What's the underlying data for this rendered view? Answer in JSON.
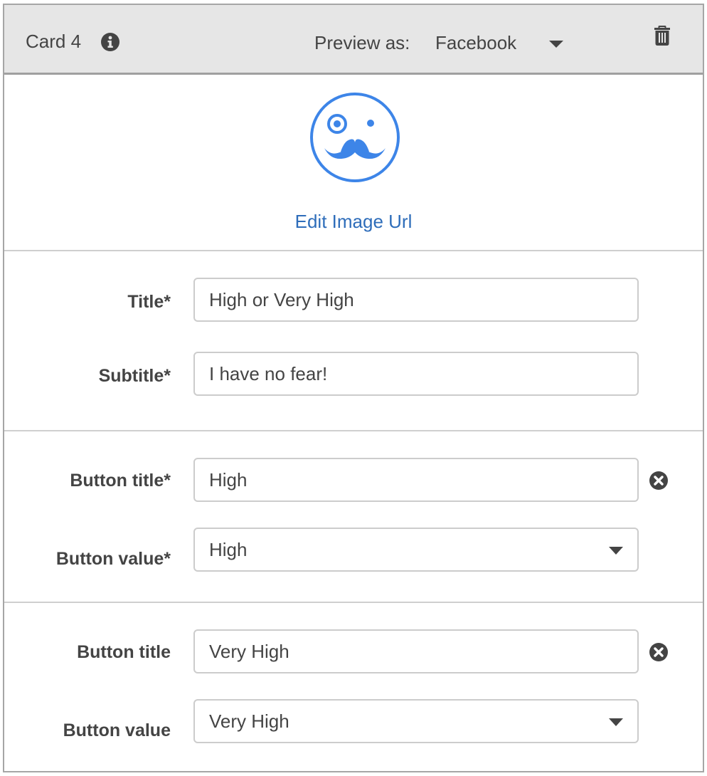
{
  "header": {
    "card_title": "Card 4",
    "info_icon": "info-circle-icon",
    "preview_label": "Preview as:",
    "preview_value": "Facebook",
    "delete_icon": "trash-icon"
  },
  "image": {
    "icon": "mustache-monocle-face-icon",
    "accent_color": "#3d85e8",
    "edit_link": "Edit Image Url"
  },
  "fields": {
    "title": {
      "label": "Title*",
      "value": "High or Very High"
    },
    "subtitle": {
      "label": "Subtitle*",
      "value": "I have no fear!"
    }
  },
  "buttons": [
    {
      "title_label": "Button title*",
      "title_value": "High",
      "value_label": "Button value*",
      "value_selected": "High",
      "remove_icon": "remove-circle-icon"
    },
    {
      "title_label": "Button title",
      "title_value": "Very High",
      "value_label": "Button value",
      "value_selected": "Very High",
      "remove_icon": "remove-circle-icon"
    }
  ],
  "colors": {
    "header_bg": "#e6e6e6",
    "link": "#2e6dba",
    "text": "#444444"
  }
}
